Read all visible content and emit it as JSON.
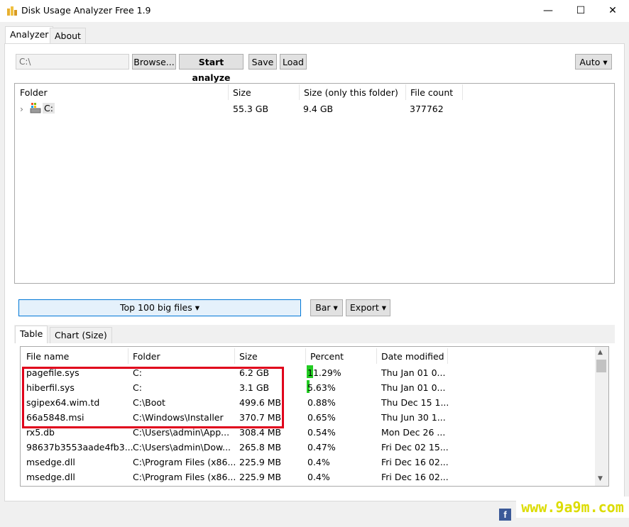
{
  "window": {
    "title": "Disk Usage Analyzer Free 1.9",
    "minimize_glyph": "—",
    "maximize_glyph": "☐",
    "close_glyph": "✕"
  },
  "top_tabs": [
    {
      "label": "Analyzer",
      "active": true
    },
    {
      "label": "About",
      "active": false
    }
  ],
  "toolbar": {
    "path_placeholder": "C:\\",
    "browse_label": "Browse...",
    "start_label": "Start analyze",
    "save_label": "Save",
    "load_label": "Load",
    "auto_label": "Auto ▾"
  },
  "tree": {
    "columns": [
      "Folder",
      "Size",
      "Size (only this folder)",
      "File count"
    ],
    "rows": [
      {
        "expander": "›",
        "name": "C:",
        "size": "55.3 GB",
        "own_size": "9.4 GB",
        "count": "377762"
      }
    ]
  },
  "lower_toolbar": {
    "top_files_label": "Top 100 big files ▾",
    "bar_label": "Bar ▾",
    "export_label": "Export ▾"
  },
  "lower_tabs": [
    {
      "label": "Table",
      "active": true
    },
    {
      "label": "Chart (Size)",
      "active": false
    }
  ],
  "files": {
    "columns": [
      "File name",
      "Folder",
      "Size",
      "Percent",
      "Date modified"
    ],
    "rows": [
      {
        "name": "pagefile.sys",
        "folder": "C:",
        "size": "6.2 GB",
        "percent": "11.29%",
        "percent_value": 11.29,
        "date": "Thu Jan 01 0..."
      },
      {
        "name": "hiberfil.sys",
        "folder": "C:",
        "size": "3.1 GB",
        "percent": "5.63%",
        "percent_value": 5.63,
        "date": "Thu Jan 01 0..."
      },
      {
        "name": "sgipex64.wim.td",
        "folder": "C:\\Boot",
        "size": "499.6 MB",
        "percent": "0.88%",
        "percent_value": 0.88,
        "date": "Thu Dec 15 1..."
      },
      {
        "name": "66a5848.msi",
        "folder": "C:\\Windows\\Installer",
        "size": "370.7 MB",
        "percent": "0.65%",
        "percent_value": 0.65,
        "date": "Thu Jun 30 1..."
      },
      {
        "name": "rx5.db",
        "folder": "C:\\Users\\admin\\App...",
        "size": "308.4 MB",
        "percent": "0.54%",
        "percent_value": 0.54,
        "date": "Mon Dec 26 ..."
      },
      {
        "name": "98637b3553aade4fb3...",
        "folder": "C:\\Users\\admin\\Dow...",
        "size": "265.8 MB",
        "percent": "0.47%",
        "percent_value": 0.47,
        "date": "Fri Dec 02 15..."
      },
      {
        "name": "msedge.dll",
        "folder": "C:\\Program Files (x86...",
        "size": "225.9 MB",
        "percent": "0.4%",
        "percent_value": 0.4,
        "date": "Fri Dec 16 02..."
      },
      {
        "name": "msedge.dll",
        "folder": "C:\\Program Files (x86...",
        "size": "225.9 MB",
        "percent": "0.4%",
        "percent_value": 0.4,
        "date": "Fri Dec 16 02..."
      }
    ]
  },
  "watermark": "www.9a9m.com",
  "facebook_glyph": "f",
  "colors": {
    "highlight_box": "#e0001b",
    "percent_bar": "#22cc22",
    "accent": "#0078d7"
  }
}
